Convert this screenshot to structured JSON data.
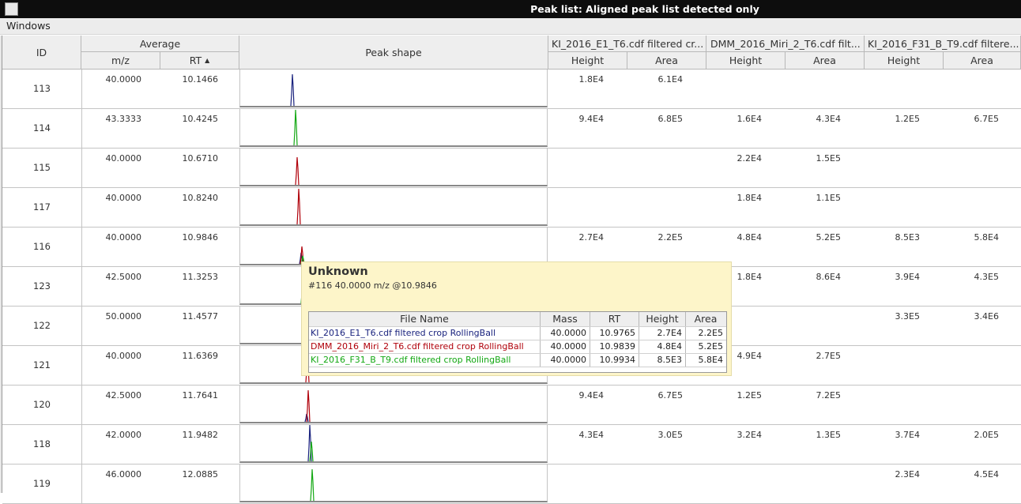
{
  "window": {
    "title": "Peak list: Aligned peak list detected only"
  },
  "menu": {
    "windows": "Windows"
  },
  "headers": {
    "id": "ID",
    "average": "Average",
    "mz": "m/z",
    "rt": "RT",
    "sort_icon": "sort-ascending-icon",
    "peak_shape": "Peak shape",
    "files": [
      "KI_2016_E1_T6.cdf filtered cr...",
      "DMM_2016_Miri_2_T6.cdf filt...",
      "KI_2016_F31_B_T9.cdf filtere..."
    ],
    "height": "Height",
    "area": "Area"
  },
  "series_colors": [
    "#1a237e",
    "#b0000a",
    "#13a813"
  ],
  "rows": [
    {
      "id": "113",
      "mz": "40.0000",
      "rt": "10.1466",
      "f1h": "1.8E4",
      "f1a": "6.1E4",
      "f2h": "",
      "f2a": "",
      "f3h": "",
      "f3a": ""
    },
    {
      "id": "114",
      "mz": "43.3333",
      "rt": "10.4245",
      "f1h": "9.4E4",
      "f1a": "6.8E5",
      "f2h": "1.6E4",
      "f2a": "4.3E4",
      "f3h": "1.2E5",
      "f3a": "6.7E5"
    },
    {
      "id": "115",
      "mz": "40.0000",
      "rt": "10.6710",
      "f1h": "",
      "f1a": "",
      "f2h": "2.2E4",
      "f2a": "1.5E5",
      "f3h": "",
      "f3a": ""
    },
    {
      "id": "117",
      "mz": "40.0000",
      "rt": "10.8240",
      "f1h": "",
      "f1a": "",
      "f2h": "1.8E4",
      "f2a": "1.1E5",
      "f3h": "",
      "f3a": ""
    },
    {
      "id": "116",
      "mz": "40.0000",
      "rt": "10.9846",
      "f1h": "2.7E4",
      "f1a": "2.2E5",
      "f2h": "4.8E4",
      "f2a": "5.2E5",
      "f3h": "8.5E3",
      "f3a": "5.8E4"
    },
    {
      "id": "123",
      "mz": "42.5000",
      "rt": "11.3253",
      "f1h": "",
      "f1a": "",
      "f2h": "1.8E4",
      "f2a": "8.6E4",
      "f3h": "3.9E4",
      "f3a": "4.3E5"
    },
    {
      "id": "122",
      "mz": "50.0000",
      "rt": "11.4577",
      "f1h": "",
      "f1a": "",
      "f2h": "",
      "f2a": "",
      "f3h": "3.3E5",
      "f3a": "3.4E6"
    },
    {
      "id": "121",
      "mz": "40.0000",
      "rt": "11.6369",
      "f1h": "",
      "f1a": "",
      "f2h": "4.9E4",
      "f2a": "2.7E5",
      "f3h": "",
      "f3a": ""
    },
    {
      "id": "120",
      "mz": "42.5000",
      "rt": "11.7641",
      "f1h": "9.4E4",
      "f1a": "6.7E5",
      "f2h": "1.2E5",
      "f2a": "7.2E5",
      "f3h": "",
      "f3a": ""
    },
    {
      "id": "118",
      "mz": "42.0000",
      "rt": "11.9482",
      "f1h": "4.3E4",
      "f1a": "3.0E5",
      "f2h": "3.2E4",
      "f2a": "1.3E5",
      "f3h": "3.7E4",
      "f3a": "2.0E5"
    },
    {
      "id": "119",
      "mz": "46.0000",
      "rt": "12.0885",
      "f1h": "",
      "f1a": "",
      "f2h": "",
      "f2a": "",
      "f3h": "2.3E4",
      "f3a": "4.5E4"
    }
  ],
  "tooltip": {
    "title": "Unknown",
    "subtitle": "#116 40.0000 m/z @10.9846",
    "columns": [
      "File Name",
      "Mass",
      "RT",
      "Height",
      "Area"
    ],
    "rows": [
      {
        "file": "KI_2016_E1_T6.cdf filtered crop RollingBall",
        "mass": "40.0000",
        "rt": "10.9765",
        "height": "2.7E4",
        "area": "2.2E5",
        "color": "#1a237e"
      },
      {
        "file": "DMM_2016_Miri_2_T6.cdf filtered crop RollingBall",
        "mass": "40.0000",
        "rt": "10.9839",
        "height": "4.8E4",
        "area": "5.2E5",
        "color": "#b0000a"
      },
      {
        "file": "KI_2016_F31_B_T9.cdf filtered crop RollingBall",
        "mass": "40.0000",
        "rt": "10.9934",
        "height": "8.5E3",
        "area": "5.8E4",
        "color": "#13a813"
      }
    ]
  }
}
